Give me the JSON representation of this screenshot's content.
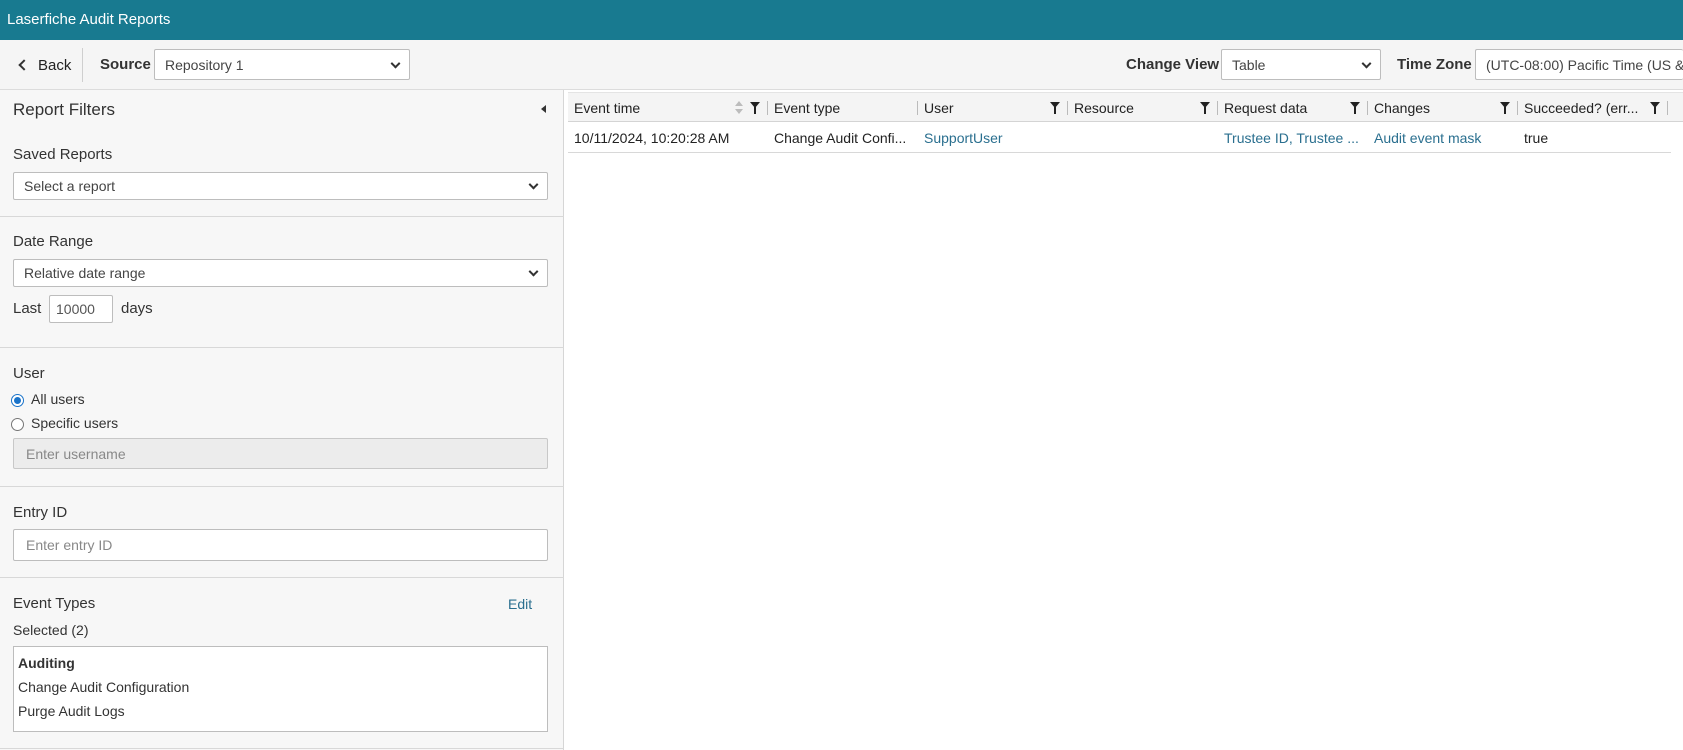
{
  "app": {
    "title": "Laserfiche Audit Reports"
  },
  "toolbar": {
    "back_label": "Back",
    "source_label": "Source",
    "source_value": "Repository 1",
    "change_view_label": "Change View",
    "change_view_value": "Table",
    "time_zone_label": "Time Zone",
    "time_zone_value": "(UTC-08:00) Pacific Time (US &"
  },
  "filters": {
    "header": "Report Filters",
    "saved_reports": {
      "label": "Saved Reports",
      "value": "Select a report"
    },
    "date_range": {
      "label": "Date Range",
      "value": "Relative date range",
      "last_label": "Last",
      "days_value": "10000",
      "days_label": "days"
    },
    "user": {
      "label": "User",
      "options": [
        "All users",
        "Specific users"
      ],
      "selected": "All users",
      "placeholder": "Enter username"
    },
    "entry_id": {
      "label": "Entry ID",
      "placeholder": "Enter entry ID"
    },
    "event_types": {
      "label": "Event Types",
      "edit_label": "Edit",
      "selected_label": "Selected (2)",
      "items": [
        "Auditing",
        "Change Audit Configuration",
        "Purge Audit Logs"
      ]
    }
  },
  "grid": {
    "columns": [
      "Event time",
      "Event type",
      "User",
      "Resource",
      "Request data",
      "Changes",
      "Succeeded? (err..."
    ],
    "rows": [
      [
        "10/11/2024, 10:20:28 AM",
        "Change Audit Confi...",
        "SupportUser",
        "",
        "Trustee ID, Trustee ...",
        "Audit event mask",
        "true"
      ]
    ]
  },
  "icons": {
    "back": "chevron-left-icon",
    "dropdown": "chevron-down-icon",
    "collapse": "collapse-left-icon",
    "filter": "filter-icon",
    "sort": "sort-icon"
  },
  "colors": {
    "titlebar": "#187a90",
    "link": "#2a6f8f",
    "radio": "#1a73c9"
  }
}
